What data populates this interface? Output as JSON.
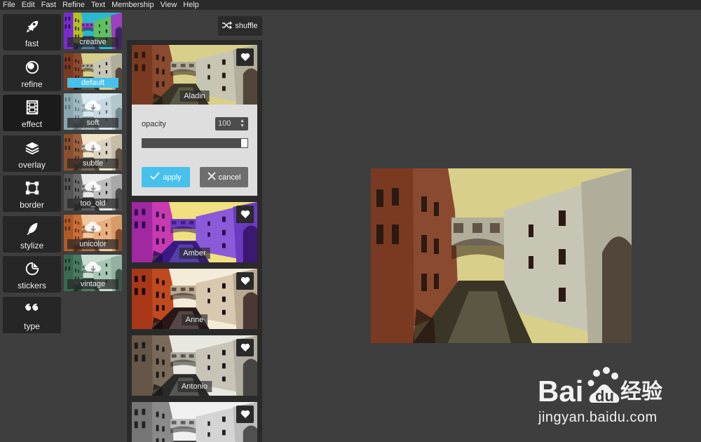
{
  "menu": [
    "File",
    "Edit",
    "Fast",
    "Refine",
    "Text",
    "Membership",
    "View",
    "Help"
  ],
  "tools": [
    {
      "label": "fast",
      "icon": "rocket-icon"
    },
    {
      "label": "refine",
      "icon": "refine-icon"
    },
    {
      "label": "effect",
      "icon": "film-icon"
    },
    {
      "label": "overlay",
      "icon": "layers-icon"
    },
    {
      "label": "border",
      "icon": "border-icon"
    },
    {
      "label": "stylize",
      "icon": "feather-icon"
    },
    {
      "label": "stickers",
      "icon": "sticker-icon"
    },
    {
      "label": "type",
      "icon": "quote-icon"
    }
  ],
  "active_tool": "effect",
  "categories": [
    {
      "label": "creative"
    },
    {
      "label": "default",
      "selected": true
    },
    {
      "label": "soft"
    },
    {
      "label": "subtle"
    },
    {
      "label": "too_old"
    },
    {
      "label": "unicolor"
    },
    {
      "label": "vintage"
    }
  ],
  "shuffle_label": "shuffle",
  "filters": [
    {
      "label": "Aladin",
      "expanded": true
    },
    {
      "label": "Amber"
    },
    {
      "label": "Anne"
    },
    {
      "label": "Antonio"
    },
    {
      "label": ""
    }
  ],
  "panel": {
    "opacity_label": "opacity",
    "opacity_value": "100",
    "opacity_level": 1.0,
    "apply_label": "apply",
    "cancel_label": "cancel"
  },
  "watermark": {
    "brand": "Bai 经验",
    "url": "jingyan.baidu.com"
  },
  "colors": {
    "accent": "#47c1ec",
    "background": "#3e3e3e",
    "panel": "#2a2a2a"
  }
}
